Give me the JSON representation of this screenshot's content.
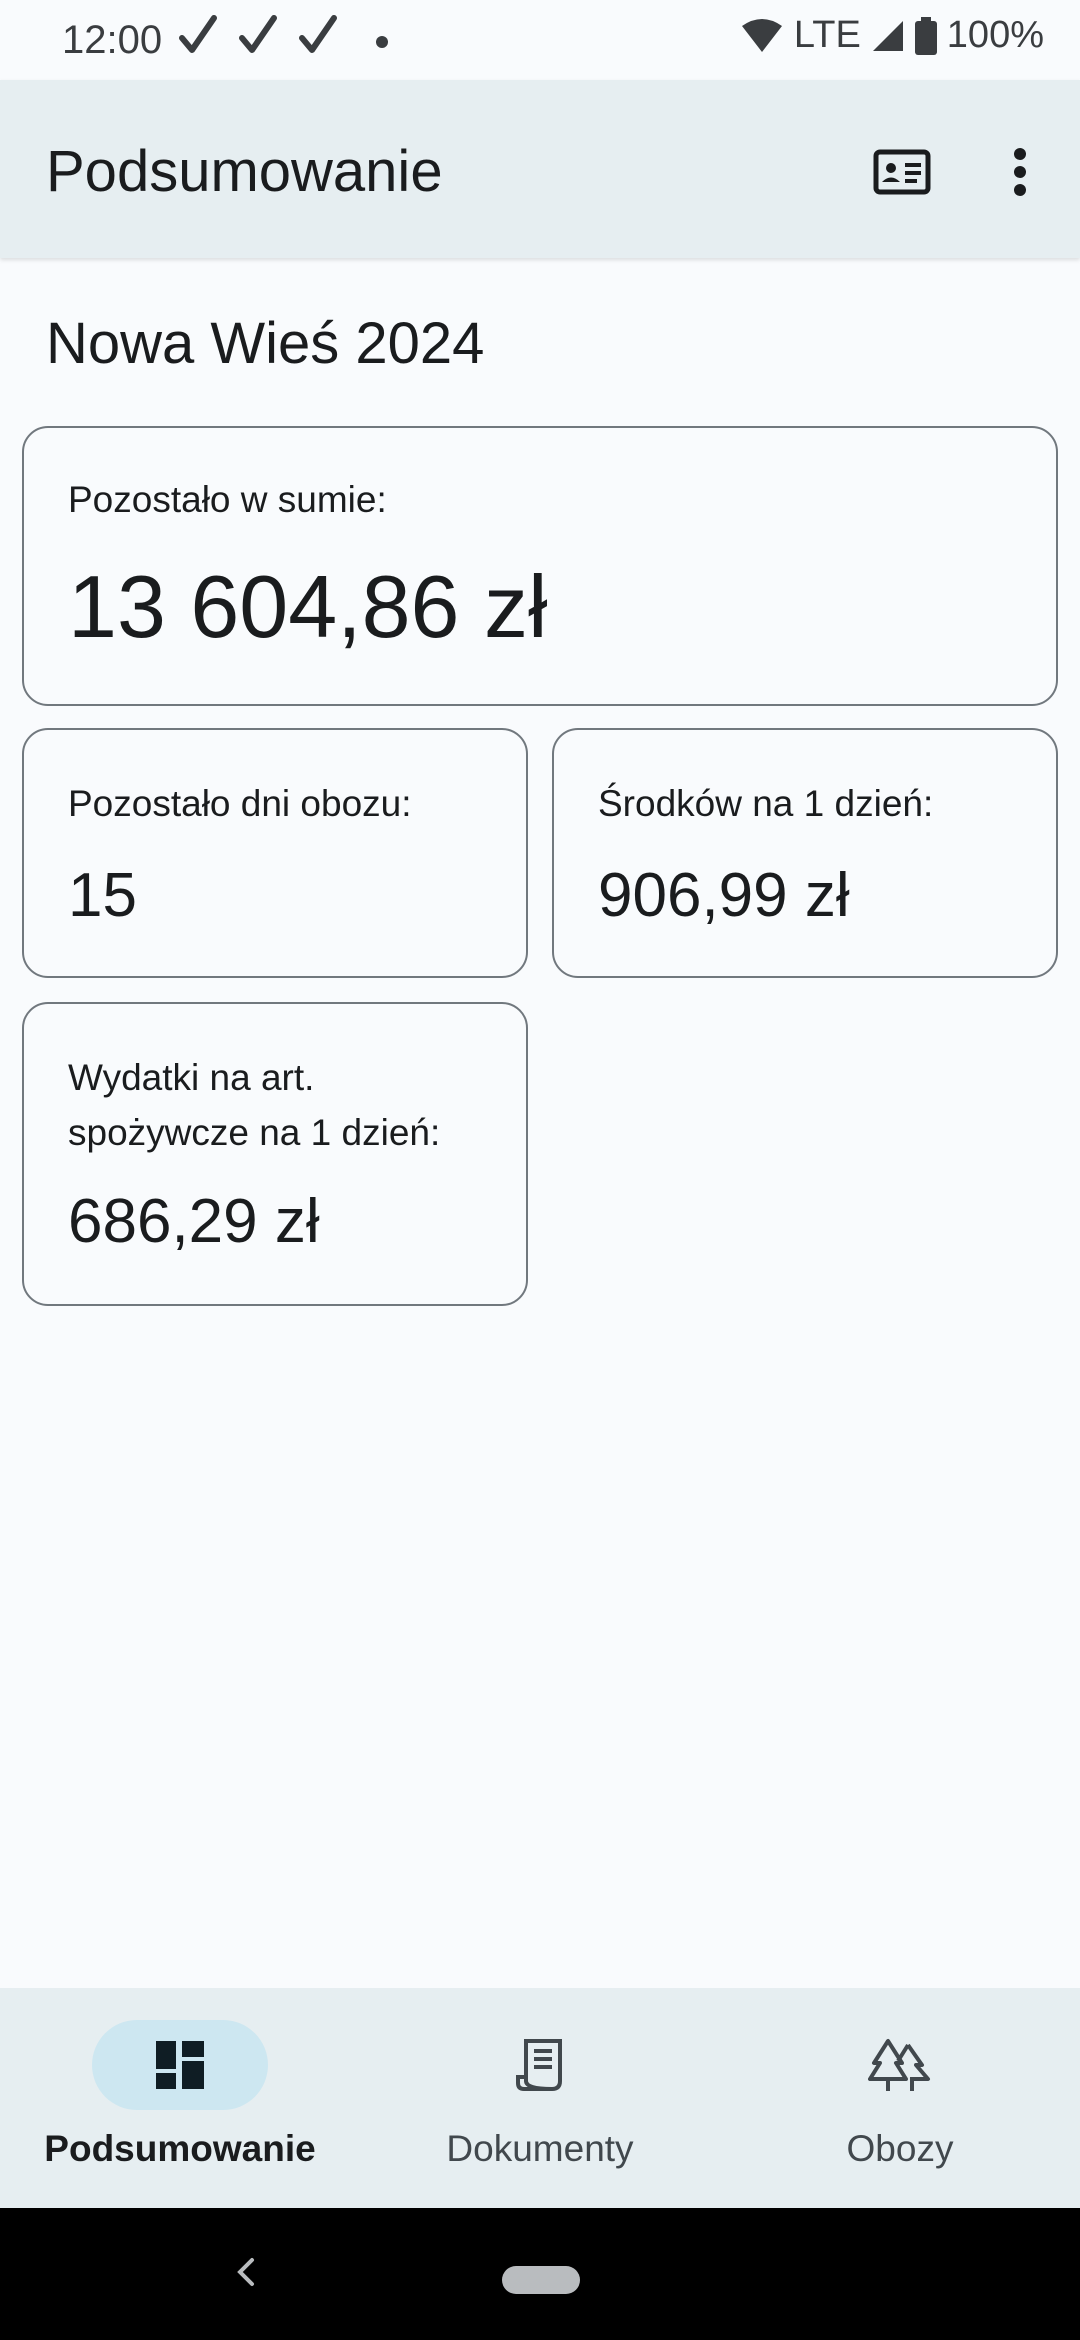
{
  "status_bar": {
    "time": "12:00",
    "network": "LTE",
    "battery": "100%",
    "icons": [
      "check-icon",
      "check-icon",
      "check-icon",
      "notification-dot-icon",
      "wifi-icon",
      "signal-icon",
      "battery-icon"
    ]
  },
  "app_bar": {
    "title": "Podsumowanie",
    "actions": [
      "contact-card-icon",
      "more-vert-icon"
    ]
  },
  "camp": {
    "name": "Nowa Wieś 2024"
  },
  "cards": {
    "remaining_total": {
      "label": "Pozostało w sumie:",
      "value": "13 604,86 zł"
    },
    "remaining_days": {
      "label": "Pozostało dni obozu:",
      "value": "15"
    },
    "funds_per_day": {
      "label": "Środków na 1 dzień:",
      "value": "906,99 zł"
    },
    "food_per_day": {
      "label_line1": "Wydatki na art.",
      "label_line2": "spożywcze na 1 dzień:",
      "value": "686,29 zł"
    }
  },
  "bottom_nav": {
    "items": [
      {
        "label": "Podsumowanie",
        "icon": "dashboard-icon",
        "active": true
      },
      {
        "label": "Dokumenty",
        "icon": "receipt-icon",
        "active": false
      },
      {
        "label": "Obozy",
        "icon": "forest-icon",
        "active": false
      }
    ]
  },
  "colors": {
    "background": "#f9fbfd",
    "app_bar": "#e6eef1",
    "active_pill": "#cde7f1",
    "card_border": "#71787e"
  }
}
